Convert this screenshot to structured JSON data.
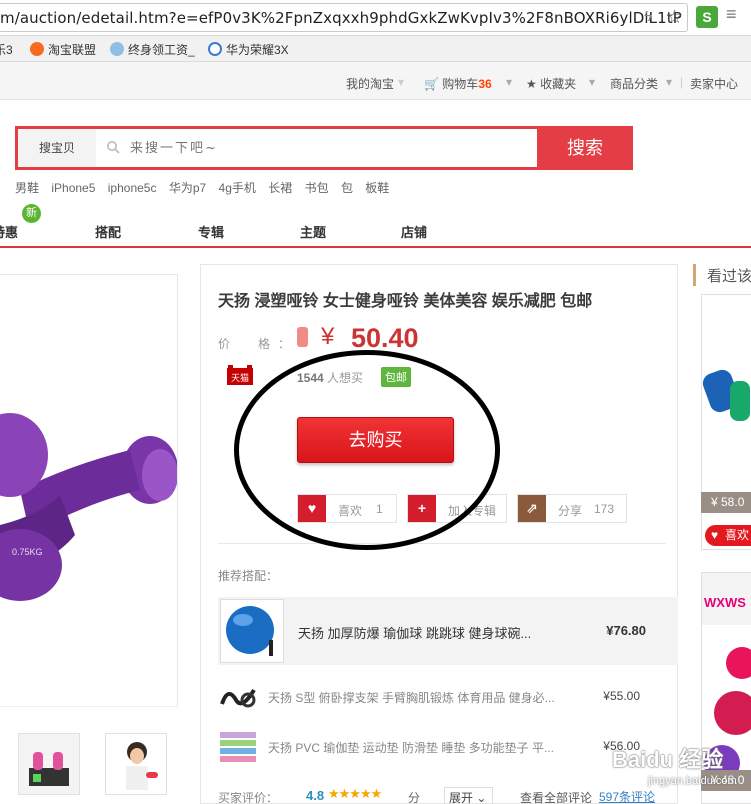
{
  "browser": {
    "url": "m/auction/edetail.htm?e=efP0v3K%2FpnZxqxxh9phdGxkZwKvpIv3%2F8nBOXRi6ylDlL1tP",
    "bookmarks": [
      {
        "label": "乐3"
      },
      {
        "label": "淘宝联盟"
      },
      {
        "label": "终身领工资_"
      },
      {
        "label": "华为荣耀3X"
      }
    ]
  },
  "topnav": {
    "my_taobao": "我的淘宝",
    "cart_label": "购物车",
    "cart_count": "36",
    "favorites": "收藏夹",
    "categories": "商品分类",
    "seller_center": "卖家中心"
  },
  "search": {
    "category": "搜宝贝",
    "placeholder": "来搜一下吧~",
    "button": "搜索",
    "hotwords": [
      "男鞋",
      "iPhone5",
      "iphone5c",
      "华为p7",
      "4g手机",
      "长裙",
      "书包",
      "包",
      "板鞋"
    ]
  },
  "catnav": {
    "new_badge": "新",
    "items": [
      "特惠",
      "搭配",
      "专辑",
      "主题",
      "店铺"
    ]
  },
  "product": {
    "title": "天扬 浸塑哑铃 女士健身哑铃 美体美容 娱乐减肥 包邮",
    "price_label": "价　格：",
    "yen": "¥",
    "price": "50.40",
    "tmall_label": "天猫",
    "want_count": "1544",
    "want_suffix": " 人想买",
    "free_shipping": "包邮",
    "buy_button": "去购买",
    "image_weight_label": "0.75KG",
    "actions": {
      "like_label": "喜欢",
      "like_count": "1",
      "add_label": "加入专辑",
      "share_label": "分享",
      "share_count": "173"
    },
    "recommend_label": "推荐搭配：",
    "recommendations": [
      {
        "name": "天扬 加厚防爆 瑜伽球 跳跳球 健身球碗...",
        "price": "¥76.80"
      },
      {
        "name": "天扬 S型 俯卧撑支架 手臂胸肌锻炼 体育用品 健身必...",
        "price": "¥55.00"
      },
      {
        "name": "天扬 PVC 瑜伽垫 运动垫 防滑垫 睡垫 多功能垫子 平...",
        "price": "¥56.00"
      }
    ],
    "rating": {
      "label": "买家评价：",
      "score": "4.8",
      "stars_value": 4.8,
      "stars": "★★★★★",
      "unit": "分",
      "expand": "展开",
      "view_all": "查看全部评论",
      "review_count": "597条评论"
    }
  },
  "sidebar": {
    "title": "看过该",
    "card1_price": "¥ 58.0",
    "card1_like": "喜欢",
    "card2_banner": "WXWS",
    "card2_price": "¥ 48.0"
  },
  "watermark": {
    "text": "Baidu 经验",
    "url": "jingyan.baidu.com"
  }
}
